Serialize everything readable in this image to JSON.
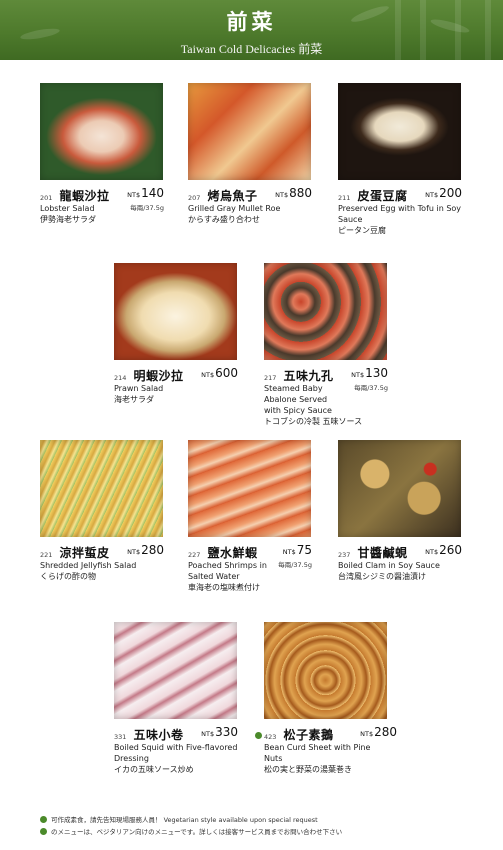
{
  "header": {
    "title_zh": "前菜",
    "title_en": "Taiwan Cold Delicacies  前菜"
  },
  "dishes": [
    {
      "code": "201",
      "name": "龍蝦沙拉",
      "currency": "NT$",
      "price": "140",
      "per": "每兩/37.5g",
      "en": "Lobster Salad",
      "jp": "伊勢海老サラダ",
      "photo": "lobster-salad-photo",
      "vegetarian": false
    },
    {
      "code": "207",
      "name": "烤烏魚子",
      "currency": "NT$",
      "price": "880",
      "per": "",
      "en": "Grilled Gray Mullet Roe",
      "jp": "からすみ盛り合わせ",
      "photo": "mullet-roe-photo",
      "vegetarian": false
    },
    {
      "code": "211",
      "name": "皮蛋豆腐",
      "currency": "NT$",
      "price": "200",
      "per": "",
      "en": "Preserved Egg with Tofu in Soy Sauce",
      "jp": "ピータン豆腐",
      "photo": "preserved-egg-tofu-photo",
      "vegetarian": false
    },
    {
      "code": "214",
      "name": "明蝦沙拉",
      "currency": "NT$",
      "price": "600",
      "per": "",
      "en": "Prawn Salad",
      "jp": "海老サラダ",
      "photo": "prawn-salad-photo",
      "vegetarian": false
    },
    {
      "code": "217",
      "name": "五味九孔",
      "currency": "NT$",
      "price": "130",
      "per": "每兩/37.5g",
      "en": "Steamed Baby Abalone Served with Spicy Sauce",
      "jp": "トコブシの冷製 五味ソース",
      "photo": "abalone-photo",
      "vegetarian": false
    },
    {
      "code": "221",
      "name": "涼拌蜇皮",
      "currency": "NT$",
      "price": "280",
      "per": "",
      "en": "Shredded Jellyfish Salad",
      "jp": "くらげの酢の物",
      "photo": "jellyfish-photo",
      "vegetarian": false
    },
    {
      "code": "227",
      "name": "鹽水鮮蝦",
      "currency": "NT$",
      "price": "75",
      "per": "每兩/37.5g",
      "en": "Poached Shrimps in Salted Water",
      "jp": "車海老の塩味煮付け",
      "photo": "shrimp-photo",
      "vegetarian": false
    },
    {
      "code": "237",
      "name": "甘醬鹹蜆",
      "currency": "NT$",
      "price": "260",
      "per": "",
      "en": "Boiled Clam in Soy Sauce",
      "jp": "台湾風シジミの醤油漬け",
      "photo": "clam-photo",
      "vegetarian": false
    },
    {
      "code": "331",
      "name": "五味小卷",
      "currency": "NT$",
      "price": "330",
      "per": "",
      "en": "Boiled Squid with Five-flavored Dressing",
      "jp": "イカの五味ソース炒め",
      "photo": "squid-photo",
      "vegetarian": false
    },
    {
      "code": "423",
      "name": "松子素鵝",
      "currency": "NT$",
      "price": "280",
      "per": "",
      "en": "Bean Curd Sheet with Pine Nuts",
      "jp": "松の実と野菜の湯葉巻き",
      "photo": "bean-curd-photo",
      "vegetarian": true
    }
  ],
  "footer": {
    "line1": "可作成素食，請先告知現場服務人員！  Vegetarian style available upon special request",
    "line2": "のメニューは、ベジタリアン向けのメニューです。詳しくは接客サービス員までお問い合わせ下さい"
  },
  "colors": {
    "banner": "#4e7a2c",
    "vegetarian_dot": "#4b8a2a"
  }
}
